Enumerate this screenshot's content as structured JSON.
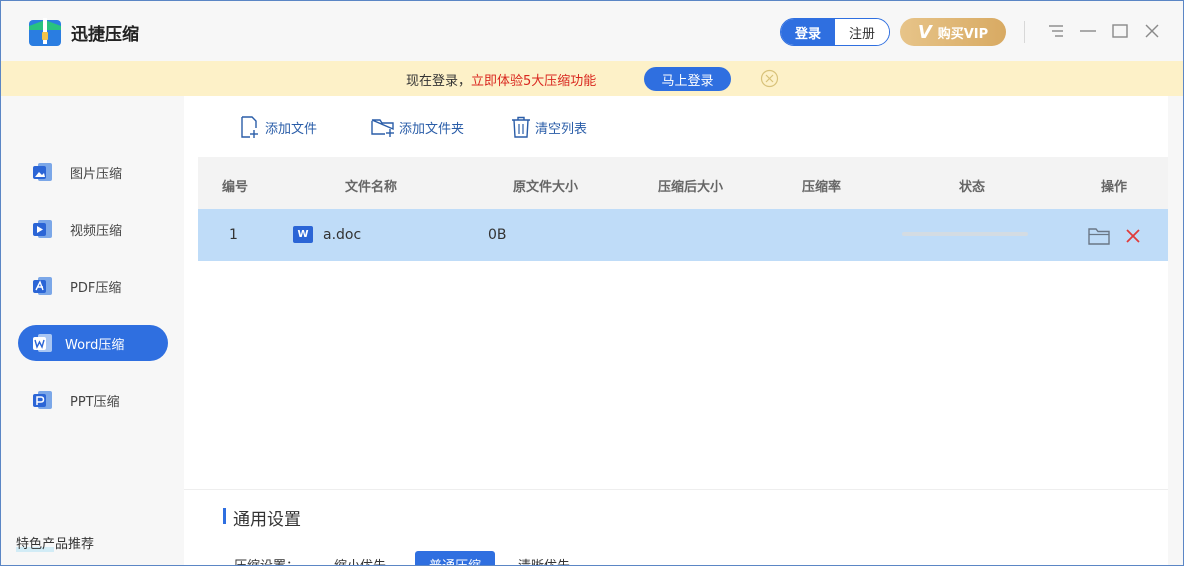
{
  "app": {
    "title": "迅捷压缩"
  },
  "header": {
    "login_label": "登录",
    "register_label": "注册",
    "vip_label": "购买VIP",
    "vip_mark": "V"
  },
  "banner": {
    "text_prefix": "现在登录，",
    "text_highlight": "立即体验5大压缩功能",
    "login_label": "马上登录"
  },
  "sidebar": {
    "items": [
      {
        "label": "图片压缩",
        "icon": "image-compress-icon",
        "active": false
      },
      {
        "label": "视频压缩",
        "icon": "video-compress-icon",
        "active": false
      },
      {
        "label": "PDF压缩",
        "icon": "pdf-compress-icon",
        "active": false
      },
      {
        "label": "Word压缩",
        "icon": "word-compress-icon",
        "active": true
      },
      {
        "label": "PPT压缩",
        "icon": "ppt-compress-icon",
        "active": false
      }
    ],
    "featured_label": "特色产品推荐"
  },
  "toolbar": {
    "add_file": "添加文件",
    "add_folder": "添加文件夹",
    "clear_list": "清空列表"
  },
  "table": {
    "columns": [
      "编号",
      "文件名称",
      "原文件大小",
      "压缩后大小",
      "压缩率",
      "状态",
      "操作"
    ],
    "rows": [
      {
        "index": "1",
        "name": "a.doc",
        "badge": "W",
        "original_size": "0B",
        "compressed_size": "",
        "ratio": "",
        "progress": 0
      }
    ]
  },
  "settings": {
    "title": "通用设置",
    "compress_label": "压缩设置：",
    "options": [
      "缩小优先",
      "普通压缩",
      "清晰优先"
    ],
    "selected": "普通压缩"
  },
  "colors": {
    "accent": "#2f6fe0",
    "banner_bg": "#fdf1c8",
    "highlight_red": "#d9281f",
    "selected_row": "#bfdcf8",
    "vip_gold": "#ddb170"
  }
}
